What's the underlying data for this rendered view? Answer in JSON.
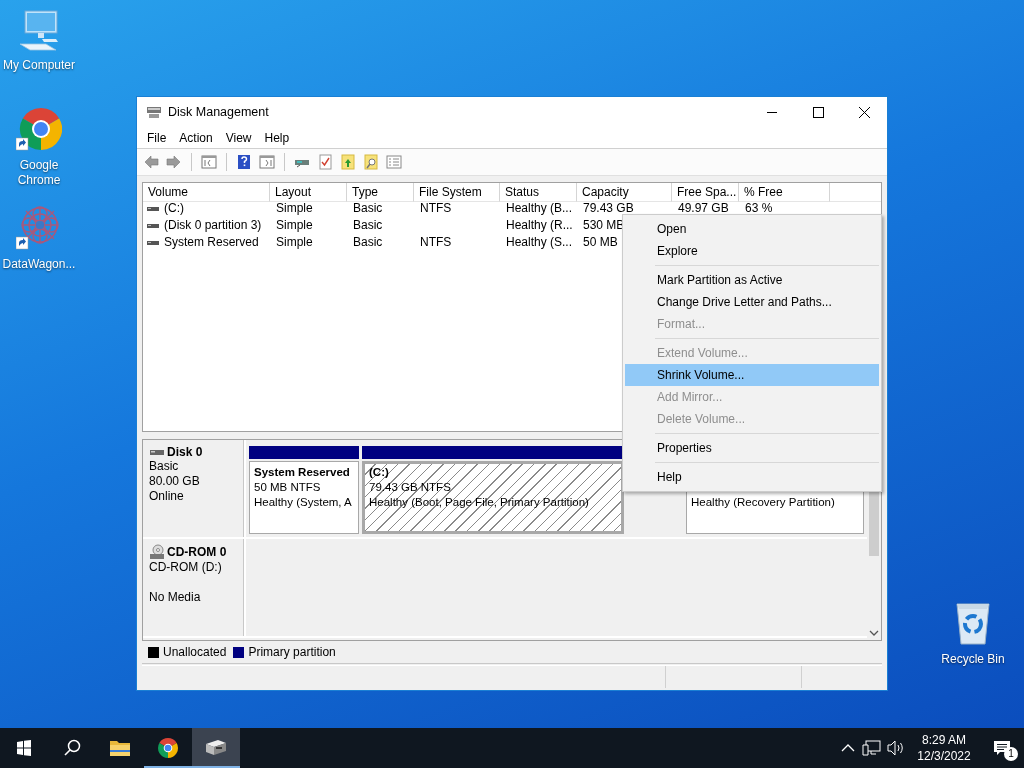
{
  "desktop_icons": [
    {
      "label": "My Computer",
      "kind": "computer"
    },
    {
      "label": "Google Chrome",
      "kind": "chrome"
    },
    {
      "label": "DataWagon...",
      "kind": "datawagon"
    },
    {
      "label": "Recycle Bin",
      "kind": "recycle"
    }
  ],
  "window": {
    "title": "Disk Management",
    "menu": [
      "File",
      "Action",
      "View",
      "Help"
    ],
    "table": {
      "columns": [
        "Volume",
        "Layout",
        "Type",
        "File System",
        "Status",
        "Capacity",
        "Free Spa...",
        "% Free"
      ],
      "rows": [
        {
          "volume": "(C:)",
          "layout": "Simple",
          "type": "Basic",
          "file_system": "NTFS",
          "status": "Healthy (B...",
          "capacity": "79.43 GB",
          "free_space": "49.97 GB",
          "percent_free": "63 %"
        },
        {
          "volume": "(Disk 0 partition 3)",
          "layout": "Simple",
          "type": "Basic",
          "status": "Healthy (R...",
          "capacity": "530 MB"
        },
        {
          "volume": "System Reserved",
          "layout": "Simple",
          "type": "Basic",
          "file_system": "NTFS",
          "status": "Healthy (S...",
          "capacity": "50 MB"
        }
      ]
    },
    "disk_map": {
      "disks": [
        {
          "kind": "disk",
          "name": "Disk 0",
          "type": "Basic",
          "size": "80.00 GB",
          "state": "Online",
          "partitions": [
            {
              "title": "System Reserved",
              "size": "50 MB NTFS",
              "status": "Healthy (System, A",
              "selected": false
            },
            {
              "title": "(C:)",
              "size": "79.43 GB NTFS",
              "status": "Healthy (Boot, Page File, Primary Partition)",
              "selected": true
            },
            {
              "status": "Healthy (Recovery Partition)",
              "selected": false
            }
          ]
        },
        {
          "kind": "cdrom",
          "name": "CD-ROM 0",
          "type": "CD-ROM (D:)",
          "state": "No Media"
        }
      ]
    },
    "legend": [
      {
        "label": "Unallocated",
        "color": "#000000"
      },
      {
        "label": "Primary partition",
        "color": "#000080"
      }
    ],
    "context_menu": [
      {
        "kind": "item",
        "label": "Open",
        "disabled": false,
        "selected": false
      },
      {
        "kind": "item",
        "label": "Explore",
        "disabled": false,
        "selected": false
      },
      {
        "kind": "separator"
      },
      {
        "kind": "item",
        "label": "Mark Partition as Active",
        "disabled": false,
        "selected": false
      },
      {
        "kind": "item",
        "label": "Change Drive Letter and Paths...",
        "disabled": false,
        "selected": false
      },
      {
        "kind": "item",
        "label": "Format...",
        "disabled": true,
        "selected": false
      },
      {
        "kind": "separator"
      },
      {
        "kind": "item",
        "label": "Extend Volume...",
        "disabled": true,
        "selected": false
      },
      {
        "kind": "item",
        "label": "Shrink Volume...",
        "disabled": false,
        "selected": true
      },
      {
        "kind": "item",
        "label": "Add Mirror...",
        "disabled": true,
        "selected": false
      },
      {
        "kind": "item",
        "label": "Delete Volume...",
        "disabled": true,
        "selected": false
      },
      {
        "kind": "separator"
      },
      {
        "kind": "item",
        "label": "Properties",
        "disabled": false,
        "selected": false
      },
      {
        "kind": "separator"
      },
      {
        "kind": "item",
        "label": "Help",
        "disabled": false,
        "selected": false
      }
    ]
  },
  "taskbar": {
    "apps": [
      {
        "kind": "explorer",
        "running": false,
        "focused": false
      },
      {
        "kind": "chrome",
        "running": true,
        "focused": false
      },
      {
        "kind": "disk_management",
        "running": true,
        "focused": true
      }
    ],
    "time": "8:29 AM",
    "date": "12/3/2022",
    "notifications": "1"
  }
}
